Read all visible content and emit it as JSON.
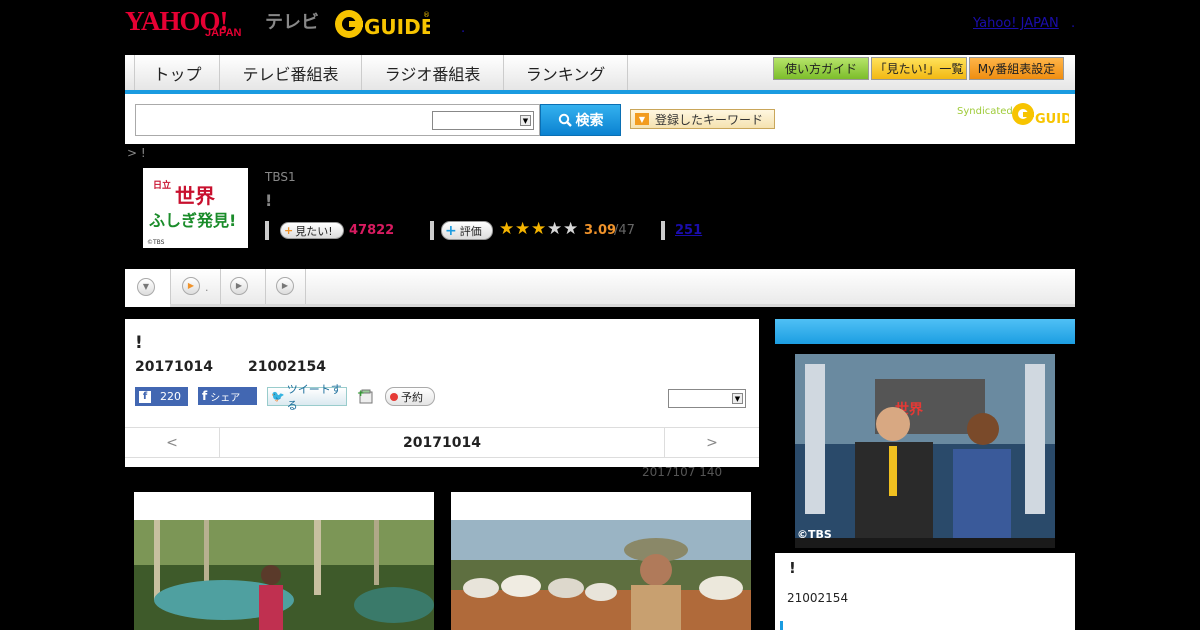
{
  "header": {
    "logo_yahoo": "YAHOO!",
    "logo_japan": "JAPAN",
    "logo_tv": "テレビ",
    "logo_gguide": "GUIDE",
    "top_link": "Yahoo! JAPAN",
    "top_dot": ".",
    "top_dot2": "."
  },
  "nav": {
    "tabs": [
      "トップ",
      "テレビ番組表",
      "ラジオ番組表",
      "ランキング"
    ],
    "guide": "使い方ガイド",
    "mitai_list": "「見たい!」一覧",
    "my_bangumi": "My番組表設定"
  },
  "search": {
    "button": "検索",
    "keyword_button": "登録したキーワード",
    "syndicated": "Syndicated"
  },
  "breadcrumb": "> !",
  "program": {
    "thumb_title_1": "世界",
    "thumb_title_2": "ふしぎ発見!",
    "thumb_tbs": "©TBS",
    "station": "TBS1",
    "title": "!",
    "mitai_label": "見たい!",
    "mitai_count": "47822",
    "rate_label": "評価",
    "rating": 3.09,
    "rating_value": "3.09",
    "rating_total": "/47",
    "review_count": "251"
  },
  "tabs": {
    "tab2_label": "."
  },
  "info": {
    "title": "!",
    "date": "20171014",
    "time": "21002154",
    "like_label": "220",
    "share_label": "シェア",
    "tweet_label": "ツイートする",
    "reserve_label": "予約",
    "prev": "<",
    "current": "20171014",
    "next": ">",
    "update_note": "2017107  140"
  },
  "side": {
    "title": "!",
    "time": "21002154",
    "credit": "©TBS"
  },
  "colors": {
    "accent_blue": "#1a9be0",
    "mitai_pink": "#d81b60",
    "rating_orange": "#f0932b"
  }
}
